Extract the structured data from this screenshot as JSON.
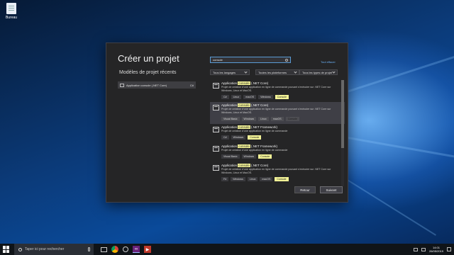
{
  "desktop": {
    "icon_label": "Bureau"
  },
  "dialog": {
    "title": "Créer un projet",
    "recent_title": "Modèles de projet récents",
    "recent_items": [
      {
        "name": "Application console (.NET Core)",
        "lang": "C#"
      }
    ],
    "search": {
      "value": "console"
    },
    "clear_all": "Tout effacer",
    "filters": {
      "language": "Tous les langages",
      "platform": "Toutes les plateformes",
      "project_type": "Tous les types de projet"
    },
    "templates": [
      {
        "prefix": "Application ",
        "highlight": "console",
        "suffix": " (.NET Core)",
        "description": "Projet de création d'une application en ligne de commande pouvant s'exécuter sur .NET Core sur Windows, Linux et MacOS.",
        "tags": [
          "C#",
          "Linux",
          "macOS",
          "Windows",
          "Console"
        ]
      },
      {
        "prefix": "Application ",
        "highlight": "console",
        "suffix": " (.NET Core)",
        "description": "Projet de création d'une application en ligne de commande pouvant s'exécuter sur .NET Core sur Windows, Linux et MacOS.",
        "tags": [
          "Visual Basic",
          "Windows",
          "Linux",
          "macOS",
          "Console"
        ]
      },
      {
        "prefix": "Application ",
        "highlight": "console",
        "suffix": " (.NET Framework)",
        "description": "Projet de création d'une application en ligne de commande",
        "tags": [
          "C#",
          "Windows",
          "Console"
        ]
      },
      {
        "prefix": "Application ",
        "highlight": "console",
        "suffix": " (.NET Framework)",
        "description": "Projet de création d'une application en ligne de commande",
        "tags": [
          "Visual Basic",
          "Windows",
          "Console"
        ]
      },
      {
        "prefix": "Application ",
        "highlight": "console",
        "suffix": " (.NET Core)",
        "description": "Projet de création d'une application en ligne de commande pouvant s'exécuter sur .NET Core sur Windows, Linux et MacOS.",
        "tags": [
          "F#",
          "Windows",
          "Linux",
          "macOS",
          "Console"
        ]
      }
    ],
    "selected_index": 1,
    "buttons": {
      "back": "Retour",
      "next": "Suivant"
    }
  },
  "taskbar": {
    "search_placeholder": "Taper ici pour rechercher",
    "time": "14:01",
    "date": "26/05/2019"
  }
}
